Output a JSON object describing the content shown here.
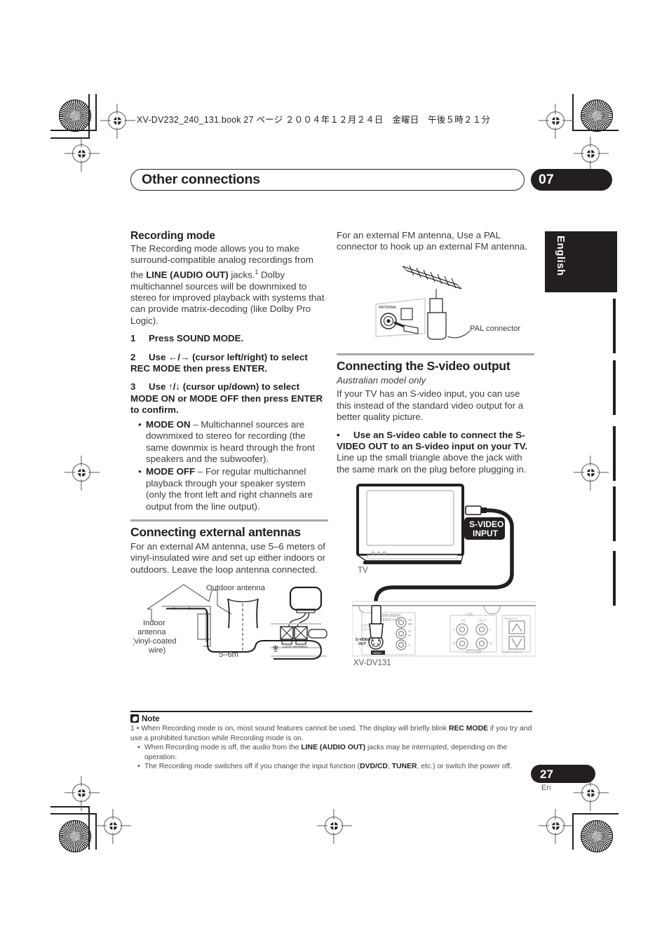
{
  "print": {
    "file_line": "XV-DV232_240_131.book  27 ページ  ２００４年１２月２４日　金曜日　午後５時２１分"
  },
  "header": {
    "chapter_title": "Other connections",
    "chapter_number": "07",
    "language_tab": "English"
  },
  "left_column": {
    "section1": {
      "heading": "Recording mode",
      "intro_a": "The Recording mode allows you to make surround-compatible analog recordings from the ",
      "intro_bold": "LINE (AUDIO OUT)",
      "intro_b": " jacks.",
      "intro_sup": "1",
      "intro_c": " Dolby multichannel sources will be downmixed to stereo for improved playback with systems that can provide matrix-decoding (like Dolby Pro Logic).",
      "steps": [
        {
          "num": "1",
          "text": "Press SOUND MODE."
        },
        {
          "num": "2",
          "text": "Use ←/→ (cursor left/right) to select REC MODE then press ENTER."
        },
        {
          "num": "3",
          "text": "Use ↑/↓ (cursor up/down) to select MODE ON or MODE OFF then press ENTER to confirm."
        }
      ],
      "bullets": [
        {
          "bold": "MODE ON",
          "text": " – Multichannel sources are downmixed to stereo for recording (the same downmix is heard through the front speakers and the subwoofer)."
        },
        {
          "bold": "MODE OFF",
          "text": " – For regular multichannel playback through your speaker system (only the front left and right channels are output from the line output)."
        }
      ]
    },
    "section2": {
      "heading": "Connecting external antennas",
      "body": "For an external AM antenna, use 5–6 meters of vinyl-insulated wire and set up either indoors or outdoors. Leave the loop antenna connected."
    },
    "figure_antenna": {
      "label_outdoor": "Outdoor antenna",
      "label_indoor_l1": "Indoor",
      "label_indoor_l2": "antenna",
      "label_indoor_l3": "(vinyl-coated",
      "label_indoor_l4": "wire)",
      "label_length": "5–6m",
      "label_loop": "LOOP ANTENNA"
    }
  },
  "right_column": {
    "fm_text": "For an external FM antenna, Use a PAL connector to hook up an external FM antenna.",
    "figure_pal": {
      "label_antenna_port": "ANTENNA",
      "label_pal": "PAL connector"
    },
    "section": {
      "heading": "Connecting the S-video output",
      "subheading": "Australian model only",
      "body1": "If your TV has an S-video input, you can use this instead of the standard video output for a better quality picture.",
      "bullet_bold": "Use an S-video cable to connect the S-VIDEO OUT to an S-video input on your TV.",
      "bullet_rest": " Line up the small triangle above the jack with the same mark on the plug before plugging in."
    },
    "figure_svideo": {
      "label_tv": "TV",
      "label_input_l1": "S-VIDEO",
      "label_input_l2": "INPUT",
      "label_model": "XV-DV131",
      "panel_labels": {
        "component": "COMPONENT",
        "video_out_comp": "VIDEO OUT",
        "cb": "Cb",
        "pb": "Pb",
        "cr": "Cr",
        "pr": "Pr",
        "y": "Y",
        "video_out": "VIDEO OUT",
        "svideo_out_l1": "S-VIDEO",
        "svideo_out_l2": "OUT",
        "video_group": "VIDEO",
        "line": "LINE",
        "in": "IN",
        "out": "OUT",
        "l": "L",
        "r": "R",
        "audio_group": "AUDIO",
        "front_r": "FRONT  R",
        "surround_r": "SURROUND R"
      }
    }
  },
  "note": {
    "heading": "Note",
    "footnote_marker": "1",
    "items": [
      {
        "text_a": "When Recording mode is on, most sound features cannot be used. The display will briefly blink ",
        "bold": "REC MODE",
        "text_b": " if you try and use a prohibited function while Recording mode is on."
      },
      {
        "text_a": "When Recording mode is off, the audio from the ",
        "bold": "LINE (AUDIO OUT)",
        "text_b": " jacks may be interrupted, depending on the operation."
      },
      {
        "text_a": "The Recording mode switches off if you change the input function (",
        "bold": "DVD/CD",
        "mid": ", ",
        "bold2": "TUNER",
        "text_b": ", etc.) or switch the power off."
      }
    ]
  },
  "footer": {
    "page_number": "27",
    "page_language": "En"
  },
  "colors": {
    "ink": "#231f20",
    "body_gray": "#3b3b3d",
    "rule_gray": "#a7a9ac"
  }
}
